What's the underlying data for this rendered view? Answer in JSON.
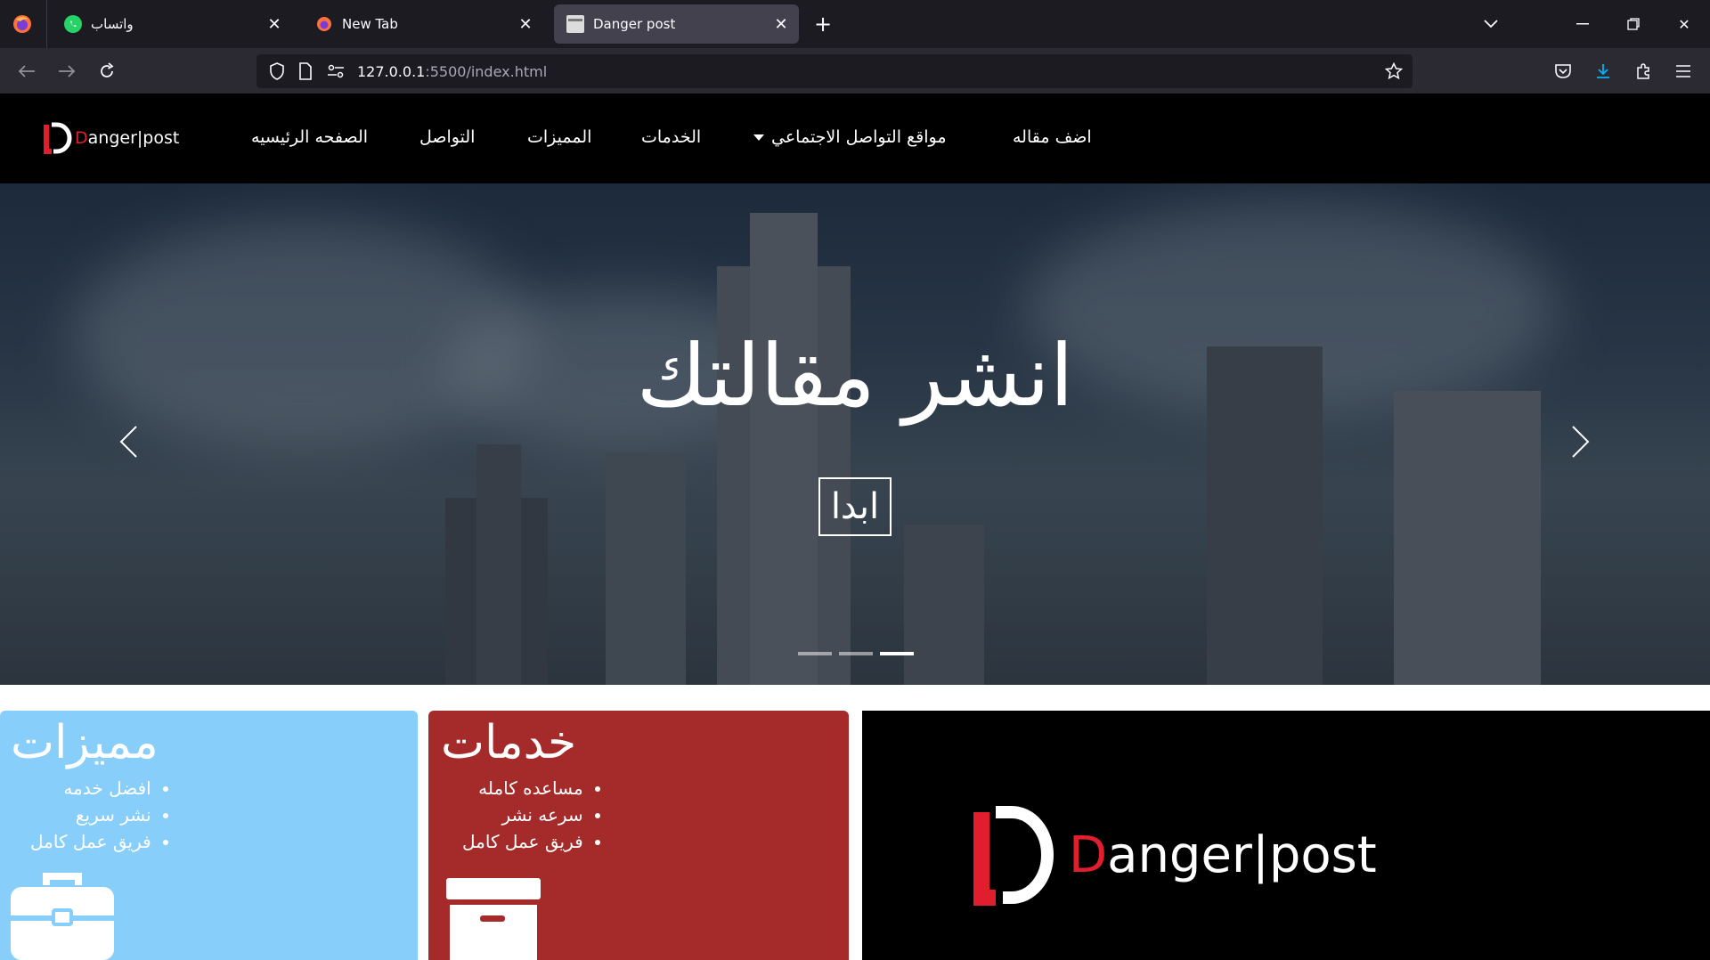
{
  "browser": {
    "tabs": [
      {
        "label": "واتساب",
        "icon": "whatsapp-icon",
        "active": false
      },
      {
        "label": "New Tab",
        "icon": "firefox-icon",
        "active": false
      },
      {
        "label": "Danger post",
        "icon": "page-icon",
        "active": true
      }
    ],
    "url_host": "127.0.0.1",
    "url_rest": ":5500/index.html"
  },
  "site": {
    "logo_text_d": "D",
    "logo_text_rest": "anger|post",
    "nav": {
      "home": "الصفحه الرئيسيه",
      "contact": "التواصل",
      "features": "المميزات",
      "services": "الخدمات",
      "social": "مواقع التواصل الاجتماعي",
      "add_article": "اضف مقاله"
    },
    "hero": {
      "title": "انشر مقالتك",
      "button": "ابدا",
      "slides": 3,
      "active_slide": 3
    },
    "cards": {
      "features": {
        "title": "مميزات",
        "items": [
          "افضل خدمه",
          "نشر سريع",
          "فريق عمل كامل"
        ],
        "color": "#87cefa",
        "icon": "briefcase-icon"
      },
      "services": {
        "title": "خدمات",
        "items": [
          "مساعده كامله",
          "سرعه نشر",
          "فريق عمل كامل"
        ],
        "color": "#a52a2a",
        "icon": "archive-box-icon"
      },
      "brand": {
        "logo_d": "D",
        "logo_rest": "anger|post",
        "color": "#000000"
      }
    }
  }
}
